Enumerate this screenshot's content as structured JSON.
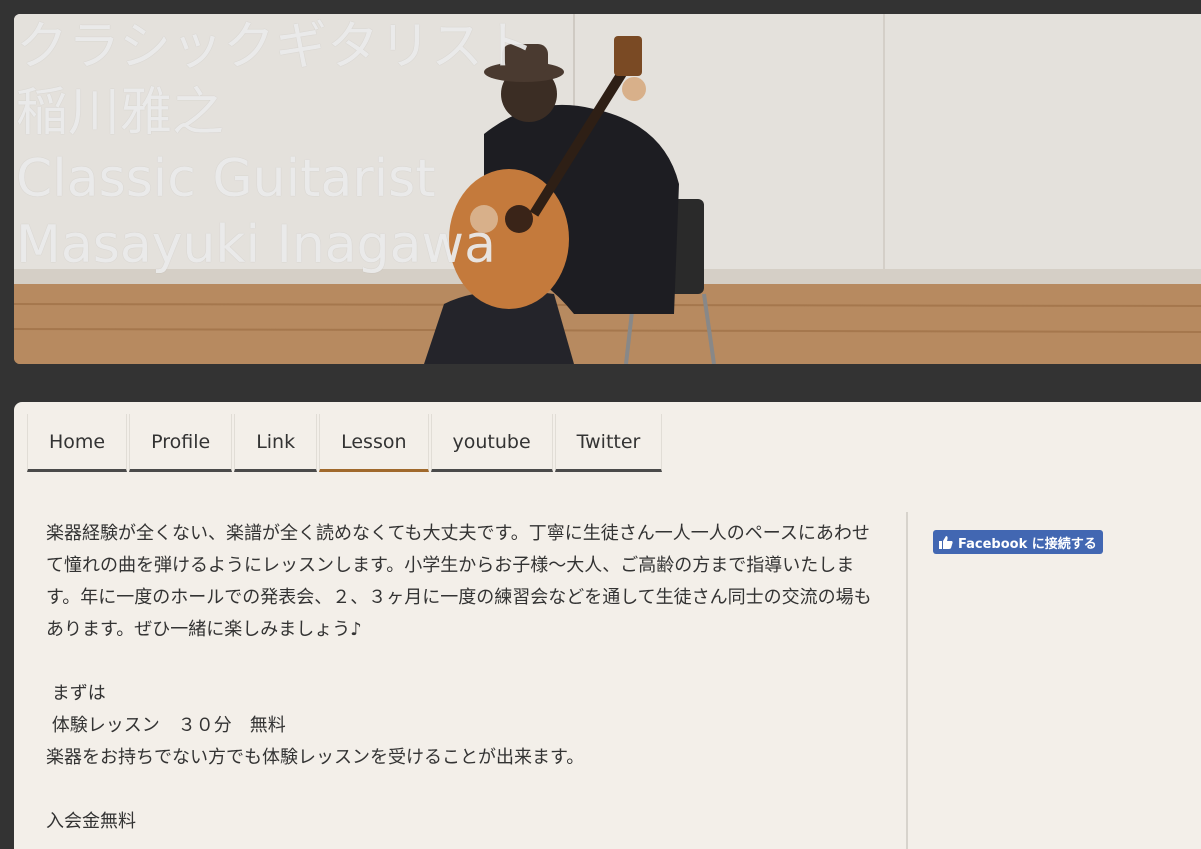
{
  "header": {
    "title_lines": [
      "クラシックギタリスト",
      "稲川雅之",
      "Classic Guitarist",
      "Masayuki Inagawa"
    ]
  },
  "nav": {
    "items": [
      {
        "label": "Home"
      },
      {
        "label": "Profile"
      },
      {
        "label": "Link"
      },
      {
        "label": "Lesson",
        "active": true
      },
      {
        "label": "youtube"
      },
      {
        "label": "Twitter"
      }
    ]
  },
  "main": {
    "intro": "楽器経験が全くない、楽譜が全く読めなくても大丈夫です。丁寧に生徒さん一人一人のペースにあわせて憧れの曲を弾けるようにレッスンします。小学生からお子様～大人、ご高齢の方まで指導いたします。年に一度のホールでの発表会、２、３ヶ月に一度の練習会などを通して生徒さん同士の交流の場もあります。ぜひ一緒に楽しみましょう♪",
    "first_label": " まずは",
    "trial_lesson": " 体験レッスン　３０分　無料",
    "trial_note": "楽器をお持ちでない方でも体験レッスンを受けることが出来ます。",
    "admission": "入会金無料"
  },
  "sidebar": {
    "facebook_button": "Facebook に接続する"
  },
  "colors": {
    "page_bg": "#333333",
    "content_bg": "#f3efe9",
    "nav_active_border": "#a0692c",
    "nav_border": "#4a4a4a",
    "facebook": "#4267b2"
  }
}
